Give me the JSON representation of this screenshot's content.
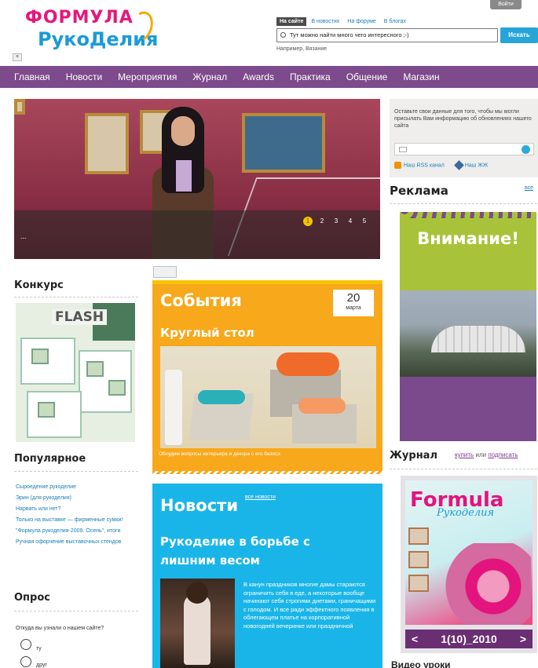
{
  "header": {
    "logo_line1": "ФОРМУЛА",
    "logo_line2": "РукоДелия",
    "login_label": "Войти",
    "search_tabs": [
      "На сайте",
      "В новостях",
      "На форуме",
      "В блогах"
    ],
    "search_value": "Тут можно найти много чего интересного ;-)",
    "search_button": "Искать",
    "search_hint": "Например, Вязание",
    "collapse_label": "×"
  },
  "nav": [
    "Главная",
    "Новости",
    "Мероприятия",
    "Журнал",
    "Awards",
    "Практика",
    "Общение",
    "Магазин"
  ],
  "hero": {
    "slides": [
      "1",
      "2",
      "3",
      "4",
      "5"
    ],
    "active_slide": "1",
    "caption": "..."
  },
  "subscribe": {
    "text": "Оставьте свои данные для того, чтобы мы могли присылать Вам информацию об обновлениях нашего сайта",
    "rss_label": "Наш RSS канал",
    "lj_label": "Наш ЖЖ"
  },
  "reklama": {
    "title": "Реклама",
    "more": "все",
    "ad_heading": "Внимание!"
  },
  "journal": {
    "title": "Журнал",
    "buy": "купить",
    "or": "или",
    "subscribe": "подписать",
    "cover_title": "Formula",
    "cover_subtitle": "Рукоделия",
    "issue": "1(10)_2010",
    "prev": "<",
    "next": ">"
  },
  "bottom_right_title": "Видео уроки",
  "konkurs": {
    "title": "Конкурс",
    "banner_label": "FLASH"
  },
  "popular": {
    "title": "Популярное",
    "items": [
      "Сыроедение рукоделие",
      "Эрин (для рукоделия)",
      "Нарвать или нет?",
      "Только на выставке — фирменные сумки!",
      "\"Формула рукоделия-2009. Осень\", итоги",
      "Ручная офорчение выставочных стендов"
    ]
  },
  "poll": {
    "title": "Опрос",
    "question": "Откуда вы узнали о нашем сайте?",
    "options": [
      "ту",
      "друг"
    ]
  },
  "events": {
    "title": "События",
    "date_day": "20",
    "date_month": "марта",
    "subtitle": "Круглый стол",
    "caption": "Обсудим вопросы интерьера и декора с его базиса"
  },
  "news": {
    "title": "Новости",
    "all_link": "все новости",
    "headline": "Рукоделие в борьбе с лишним весом",
    "text": "В канун праздников многие дамы стараются ограничить себя в еде, а некоторые вообще начинают себя строгими диетами, граничащими с голодом. И все ради эффектного появления в облегающем платье на корпоративной новогодней вечеринке или праздничной"
  },
  "colors": {
    "nav_bg": "#7d4a8c",
    "events_bg": "#f7a81b",
    "news_bg": "#1ab5e8",
    "ad_green": "#a8c33a",
    "link": "#1a7fb8"
  }
}
